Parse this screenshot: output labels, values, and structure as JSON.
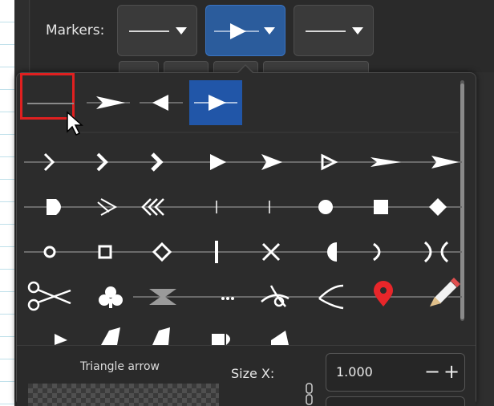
{
  "toolbar": {
    "markers_label": "Markers:",
    "marker_buttons": [
      {
        "name": "start-marker",
        "value": "none"
      },
      {
        "name": "mid-marker",
        "value": "Triangle arrow"
      },
      {
        "name": "end-marker",
        "value": "none"
      }
    ]
  },
  "popup": {
    "selected_marker": "Triangle arrow",
    "highlighted_cell": "none",
    "grid_rows": [
      [
        "none",
        "arrow-right-sharp",
        "triangle-left",
        "triangle-arrow-right"
      ],
      [
        "chevron-thin",
        "chevron",
        "chevron-bold",
        "triangle-solid",
        "arrow-concave",
        "triangle-outline",
        "arrow-narrow",
        "arrow-wide"
      ],
      [
        "arrow-rounded",
        "arrow-feather",
        "triple-chevron-left",
        "tick-left",
        "tick-right",
        "circle-solid",
        "square-solid",
        "diamond-solid"
      ],
      [
        "circle-outline",
        "square-outline",
        "diamond-outline",
        "bar",
        "cross",
        "half-circle",
        "arc-right",
        "double-arc"
      ],
      [
        "scissors",
        "club",
        "hourglass",
        "dots",
        "eye-swirl",
        "fork",
        "map-pin",
        "pencil"
      ]
    ]
  },
  "bottom": {
    "marker_name": "Triangle arrow",
    "size_x_label": "Size X:",
    "size_x_value": "1.000",
    "minus_label": "−",
    "plus_label": "+"
  },
  "colors": {
    "background": "#2e2e2e",
    "selected_cell": "#2156a8",
    "highlight_frame": "#e02020",
    "accent_button": "#2b5c9c",
    "map_pin": "#e8262a"
  }
}
